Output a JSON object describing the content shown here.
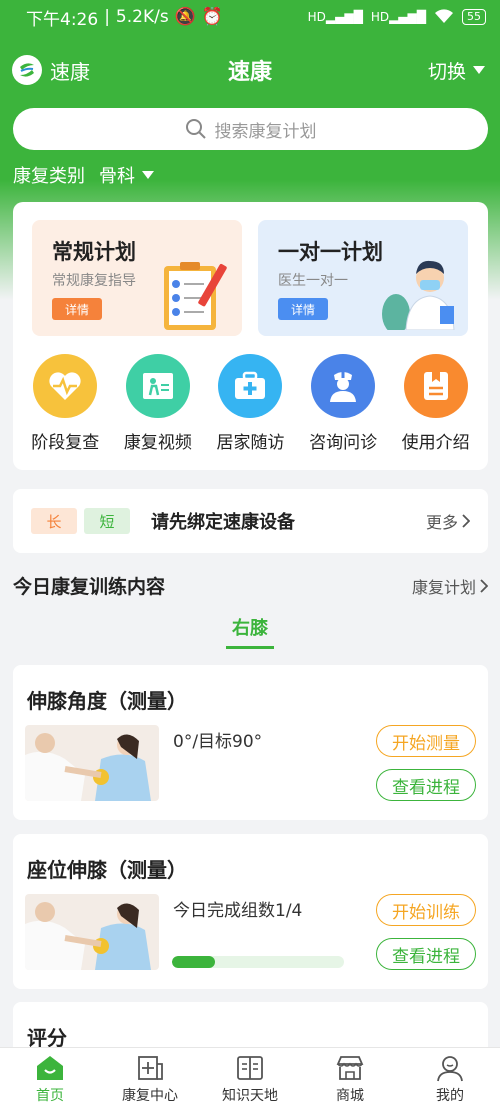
{
  "status_bar": {
    "time": "下午4:26",
    "speed": "5.2K/s",
    "battery": "55"
  },
  "header": {
    "logo_text": "速康",
    "title": "速康",
    "switch_label": "切换"
  },
  "search": {
    "placeholder": "搜索康复计划"
  },
  "category": {
    "label": "康复类别",
    "value": "骨科"
  },
  "plans": [
    {
      "title": "常规计划",
      "subtitle": "常规康复指导",
      "button": "详情"
    },
    {
      "title": "一对一计划",
      "subtitle": "医生一对一",
      "button": "详情"
    }
  ],
  "grid": [
    {
      "label": "阶段复查",
      "icon": "heart-pulse-icon",
      "color": "#f7c23c"
    },
    {
      "label": "康复视频",
      "icon": "video-person-icon",
      "color": "#3fcfa5"
    },
    {
      "label": "居家随访",
      "icon": "medical-kit-icon",
      "color": "#36b4f2"
    },
    {
      "label": "咨询问诊",
      "icon": "doctor-icon",
      "color": "#4a83e8"
    },
    {
      "label": "使用介绍",
      "icon": "document-icon",
      "color": "#f98a2f"
    }
  ],
  "device": {
    "tag_long": "长",
    "tag_short": "短",
    "text": "请先绑定速康设备",
    "more": "更多"
  },
  "today": {
    "title": "今日康复训练内容",
    "plan_link": "康复计划",
    "tab": "右膝"
  },
  "trainings": [
    {
      "title": "伸膝角度（测量）",
      "info": "0°/目标90°",
      "primary_button": "开始测量",
      "secondary_button": "查看进程"
    },
    {
      "title": "座位伸膝（测量）",
      "info": "今日完成组数1/4",
      "progress": 0.25,
      "primary_button": "开始训练",
      "secondary_button": "查看进程"
    }
  ],
  "score": {
    "title": "评分"
  },
  "nav": [
    {
      "label": "首页",
      "icon": "home-icon",
      "active": true
    },
    {
      "label": "康复中心",
      "icon": "rehab-center-icon",
      "active": false
    },
    {
      "label": "知识天地",
      "icon": "book-icon",
      "active": false
    },
    {
      "label": "商城",
      "icon": "shop-icon",
      "active": false
    },
    {
      "label": "我的",
      "icon": "profile-icon",
      "active": false
    }
  ],
  "colors": {
    "brand_green": "#3cb43c",
    "accent_orange": "#f5823b",
    "accent_blue": "#4b8ef1"
  }
}
